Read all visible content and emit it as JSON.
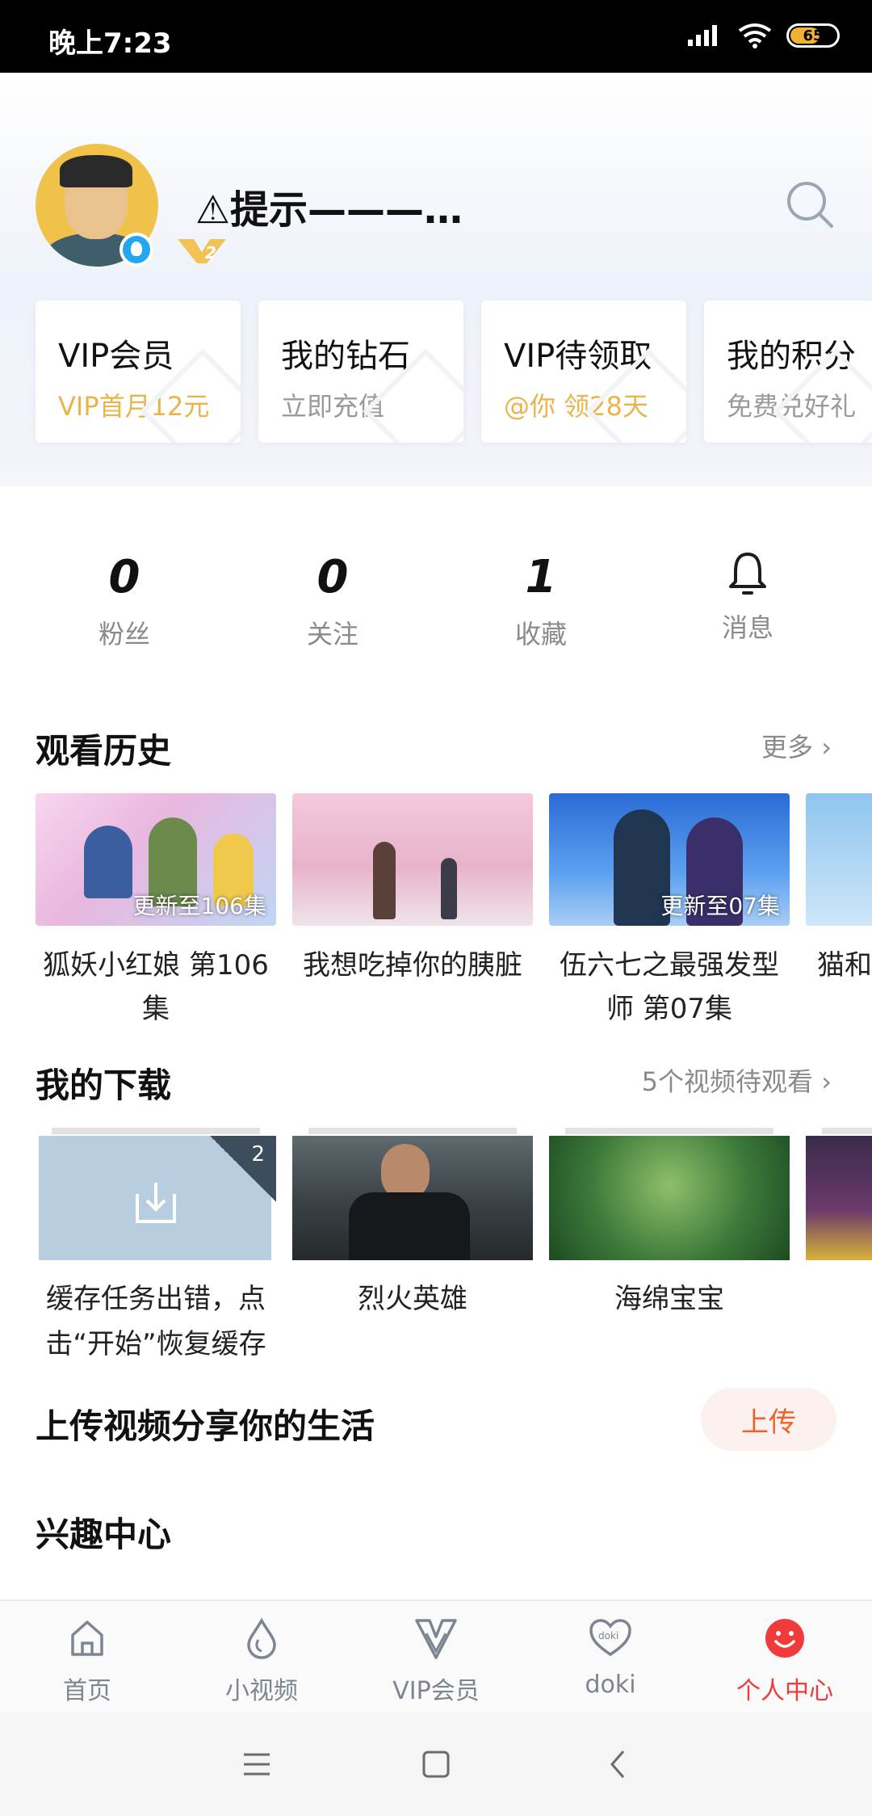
{
  "status_bar": {
    "time": "晚上7:23",
    "battery": "65"
  },
  "profile": {
    "username": "⚠提示———…"
  },
  "cards": [
    {
      "title": "VIP会员",
      "subtitle": "VIP首月12元",
      "subtitle_color": "#e9b44c"
    },
    {
      "title": "我的钻石",
      "subtitle": "立即充值",
      "subtitle_color": "#9a9a9a"
    },
    {
      "title": "VIP待领取",
      "subtitle": "@你 领28天",
      "subtitle_color": "#e9b44c"
    },
    {
      "title": "我的积分",
      "subtitle": "免费兑好礼",
      "subtitle_color": "#9a9a9a"
    }
  ],
  "stats": {
    "fans": {
      "value": "0",
      "label": "粉丝"
    },
    "following": {
      "value": "0",
      "label": "关注"
    },
    "favorites": {
      "value": "1",
      "label": "收藏"
    },
    "messages": {
      "label": "消息"
    }
  },
  "history": {
    "title": "观看历史",
    "more": "更多 ›",
    "items": [
      {
        "title": "狐妖小红娘 第106集",
        "badge": "更新至106集"
      },
      {
        "title": "我想吃掉你的胰脏",
        "badge": ""
      },
      {
        "title": "伍六七之最强发型师 第07集",
        "badge": "更新至07集"
      },
      {
        "title": "猫和",
        "badge": ""
      }
    ]
  },
  "downloads": {
    "title": "我的下载",
    "more": "5个视频待观看 ›",
    "items": [
      {
        "title": "缓存任务出错，点击“开始”恢复缓存",
        "count": "2"
      },
      {
        "title": "烈火英雄"
      },
      {
        "title": "海绵宝宝"
      },
      {
        "title": ""
      }
    ]
  },
  "upload": {
    "text": "上传视频分享你的生活",
    "button": "上传"
  },
  "interest": {
    "title": "兴趣中心"
  },
  "tabs": [
    {
      "label": "首页",
      "icon": "home-icon"
    },
    {
      "label": "小视频",
      "icon": "drop-icon"
    },
    {
      "label": "VIP会员",
      "icon": "vip-icon"
    },
    {
      "label": "doki",
      "icon": "doki-heart-icon"
    },
    {
      "label": "个人中心",
      "icon": "smile-icon",
      "active": true
    }
  ],
  "colors": {
    "accent": "#f03b3b",
    "vip_gold": "#e9b44c",
    "upload_orange": "#f0622c"
  }
}
